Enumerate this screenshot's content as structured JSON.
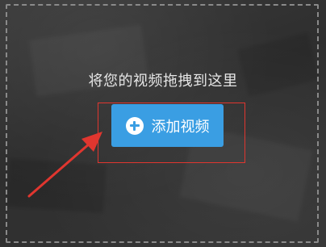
{
  "drop_zone": {
    "hint": "将您的视频拖拽到这里"
  },
  "add_video_button": {
    "label": "添加视频",
    "icon": "plus-circle-icon",
    "color": "#3a9ee3"
  },
  "annotation": {
    "highlight_color": "#e0362f",
    "arrow_color": "#e0362f"
  }
}
